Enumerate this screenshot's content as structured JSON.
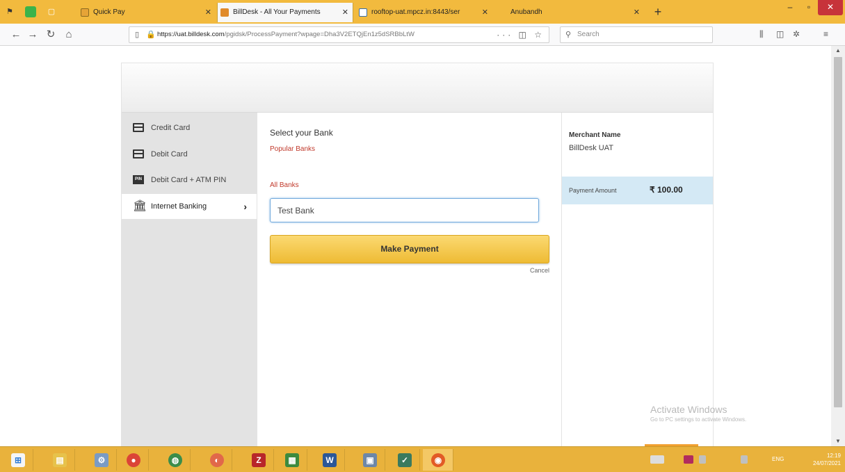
{
  "browser": {
    "tabs": [
      {
        "label": "Quick Pay",
        "active": false
      },
      {
        "label": "BillDesk - All Your Payments",
        "active": true
      },
      {
        "label": "rooftop-uat.mpcz.in:8443/ser",
        "active": false
      },
      {
        "label": "Anubandh",
        "active": false
      }
    ],
    "url_host": "https://uat.billdesk.com",
    "url_path": "/pgidsk/ProcessPayment?wpage=Dha3V2ETQjEn1z5dSRBbLtW",
    "search_placeholder": "Search"
  },
  "gateway": {
    "methods": [
      {
        "label": "Credit Card",
        "icon": "credit-card-icon"
      },
      {
        "label": "Debit Card",
        "icon": "debit-card-icon"
      },
      {
        "label": "Debit Card + ATM PIN",
        "icon": "pin-icon"
      },
      {
        "label": "Internet Banking",
        "icon": "bank-icon",
        "active": true
      }
    ],
    "select_title": "Select your Bank",
    "popular_banks": "Popular Banks",
    "all_banks": "All Banks",
    "bank_selected": "Test Bank",
    "pay_button": "Make Payment",
    "cancel": "Cancel",
    "merchant_label": "Merchant Name",
    "merchant_value": "BillDesk UAT",
    "amount_label": "Payment Amount",
    "amount_value": "₹ 100.00"
  },
  "watermark": {
    "title": "Activate Windows",
    "subtitle": "Go to PC settings to activate Windows."
  },
  "taskbar": {
    "time": "12:19",
    "date": "24/07/2021",
    "lang": "ENG"
  },
  "colors": {
    "accent": "#f2ba3e",
    "pay_button": "#eebb34",
    "link_red": "#c0392b",
    "amount_bg": "#d4e9f5"
  }
}
